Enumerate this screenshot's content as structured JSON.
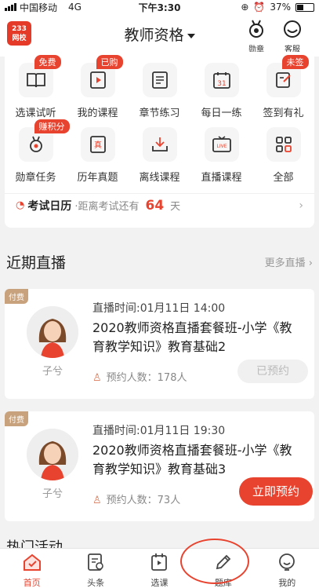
{
  "status": {
    "carrier": "中国移动",
    "network": "4G",
    "time": "下午3:30",
    "battery": "37%"
  },
  "header": {
    "logo_top": "233",
    "logo_bottom": "网校",
    "title": "教师资格",
    "medal_label": "勋章",
    "service_label": "客服"
  },
  "grid": [
    {
      "label": "选课试听",
      "icon": "book-open-icon",
      "badge": "免费"
    },
    {
      "label": "我的课程",
      "icon": "play-course-icon",
      "badge": "已购"
    },
    {
      "label": "章节练习",
      "icon": "document-list-icon",
      "badge": ""
    },
    {
      "label": "每日一练",
      "icon": "calendar-icon",
      "badge": ""
    },
    {
      "label": "签到有礼",
      "icon": "sign-in-icon",
      "badge": "未签"
    },
    {
      "label": "勋章任务",
      "icon": "medal-icon",
      "badge": "赚积分"
    },
    {
      "label": "历年真题",
      "icon": "exam-paper-icon",
      "badge": ""
    },
    {
      "label": "离线课程",
      "icon": "download-icon",
      "badge": ""
    },
    {
      "label": "直播课程",
      "icon": "live-tv-icon",
      "badge": ""
    },
    {
      "label": "全部",
      "icon": "grid-icon",
      "badge": ""
    }
  ],
  "exam": {
    "title": "考试日历",
    "prefix": "·距离考试还有",
    "days": "64",
    "unit": "天"
  },
  "live_section": {
    "title": "近期直播",
    "more": "更多直播"
  },
  "lives": [
    {
      "tag": "付费",
      "time": "直播时间:01月11日 14:00",
      "name": "2020教师资格直播套餐班-小学《教育教学知识》教育基础2",
      "teacher": "子兮",
      "count": "预约人数：178人",
      "button": "已预约"
    },
    {
      "tag": "付费",
      "time": "直播时间:01月11日 19:30",
      "name": "2020教师资格直播套餐班-小学《教育教学知识》教育基础3",
      "teacher": "子兮",
      "count": "预约人数：73人",
      "button": "立即预约"
    }
  ],
  "hot_title": "热门活动",
  "tabs": [
    {
      "label": "首页",
      "icon": "home-icon",
      "active": true
    },
    {
      "label": "头条",
      "icon": "news-icon",
      "active": false
    },
    {
      "label": "选课",
      "icon": "course-icon",
      "active": false
    },
    {
      "label": "题库",
      "icon": "pencil-icon",
      "active": false
    },
    {
      "label": "我的",
      "icon": "profile-icon",
      "active": false
    }
  ],
  "colors": {
    "accent": "#e8432f",
    "paid_tag": "#c7a27c"
  }
}
